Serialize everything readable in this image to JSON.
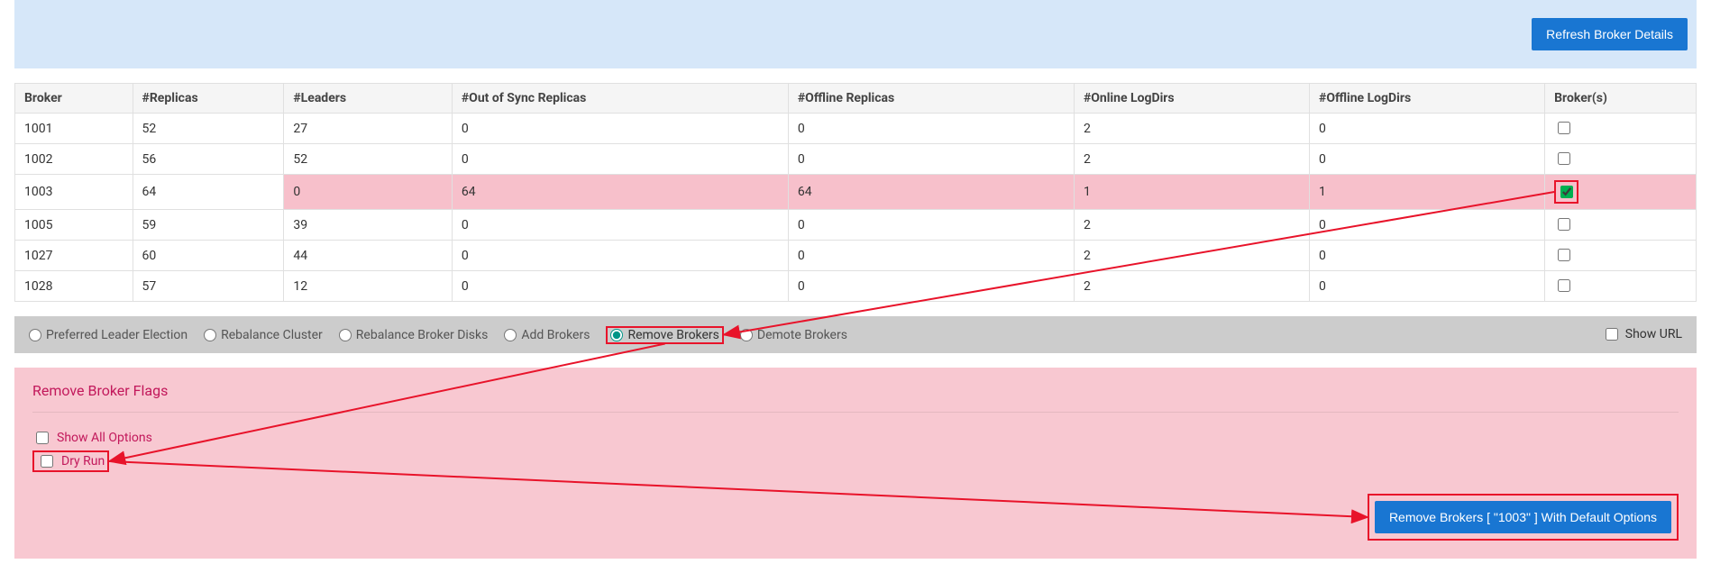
{
  "topbar": {
    "refresh_label": "Refresh Broker Details"
  },
  "table": {
    "headers": {
      "broker": "Broker",
      "replicas": "#Replicas",
      "leaders": "#Leaders",
      "out_of_sync": "#Out of Sync Replicas",
      "offline_replicas": "#Offline Replicas",
      "online_logdirs": "#Online LogDirs",
      "offline_logdirs": "#Offline LogDirs",
      "brokers_sel": "Broker(s)"
    },
    "rows": [
      {
        "broker": "1001",
        "replicas": "52",
        "leaders": "27",
        "out_of_sync": "0",
        "offline_replicas": "0",
        "online_logdirs": "2",
        "offline_logdirs": "0",
        "checked": false,
        "highlight": false
      },
      {
        "broker": "1002",
        "replicas": "56",
        "leaders": "52",
        "out_of_sync": "0",
        "offline_replicas": "0",
        "online_logdirs": "2",
        "offline_logdirs": "0",
        "checked": false,
        "highlight": false
      },
      {
        "broker": "1003",
        "replicas": "64",
        "leaders": "0",
        "out_of_sync": "64",
        "offline_replicas": "64",
        "online_logdirs": "1",
        "offline_logdirs": "1",
        "checked": true,
        "highlight": true
      },
      {
        "broker": "1005",
        "replicas": "59",
        "leaders": "39",
        "out_of_sync": "0",
        "offline_replicas": "0",
        "online_logdirs": "2",
        "offline_logdirs": "0",
        "checked": false,
        "highlight": false
      },
      {
        "broker": "1027",
        "replicas": "60",
        "leaders": "44",
        "out_of_sync": "0",
        "offline_replicas": "0",
        "online_logdirs": "2",
        "offline_logdirs": "0",
        "checked": false,
        "highlight": false
      },
      {
        "broker": "1028",
        "replicas": "57",
        "leaders": "12",
        "out_of_sync": "0",
        "offline_replicas": "0",
        "online_logdirs": "2",
        "offline_logdirs": "0",
        "checked": false,
        "highlight": false
      }
    ]
  },
  "actions": {
    "preferred": "Preferred Leader Election",
    "rebalance_cluster": "Rebalance Cluster",
    "rebalance_disks": "Rebalance Broker Disks",
    "add_brokers": "Add Brokers",
    "remove_brokers": "Remove Brokers",
    "demote_brokers": "Demote Brokers",
    "show_url": "Show URL"
  },
  "flags": {
    "title": "Remove Broker Flags",
    "show_all": "Show All Options",
    "dry_run": "Dry Run",
    "submit_label": "Remove Brokers [ \"1003\" ] With Default Options"
  },
  "colors": {
    "primary": "#1976d2",
    "highlight": "#e8132a",
    "pink_row": "#f7c0cb",
    "panel": "#f8c8d1"
  }
}
